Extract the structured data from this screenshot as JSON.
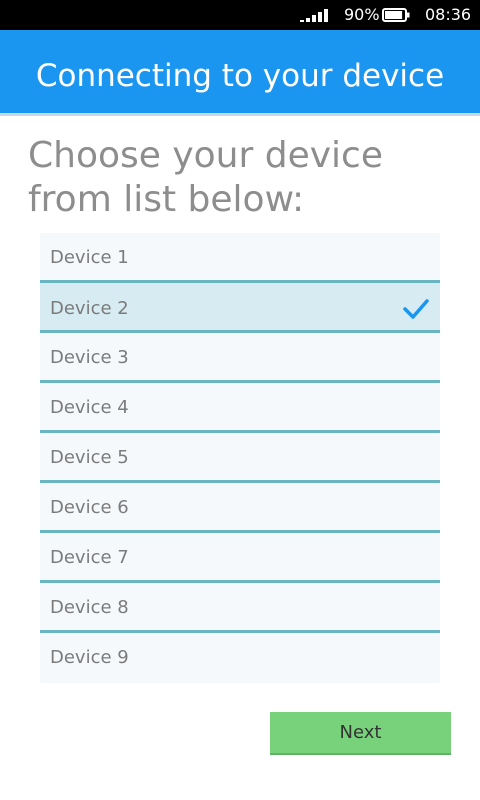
{
  "status_bar": {
    "battery_percent": "90%",
    "battery_level": 0.9,
    "time": "08:36",
    "signal_icon": "signal-strength-icon",
    "battery_icon": "battery-icon"
  },
  "header": {
    "title": "Connecting to your device",
    "background_color": "#1a96f0"
  },
  "prompt": {
    "text": "Choose your device from list below:"
  },
  "device_list": {
    "items": [
      {
        "label": "Device 1",
        "selected": false
      },
      {
        "label": "Device 2",
        "selected": true
      },
      {
        "label": "Device 3",
        "selected": false
      },
      {
        "label": "Device 4",
        "selected": false
      },
      {
        "label": "Device 5",
        "selected": false
      },
      {
        "label": "Device 6",
        "selected": false
      },
      {
        "label": "Device 7",
        "selected": false
      },
      {
        "label": "Device 8",
        "selected": false
      },
      {
        "label": "Device 9",
        "selected": false
      }
    ],
    "selected_icon": "checkmark-icon",
    "accent_color": "#1a96f0",
    "divider_color": "#69b6c2"
  },
  "footer": {
    "next_label": "Next",
    "next_color": "#78d27c"
  }
}
